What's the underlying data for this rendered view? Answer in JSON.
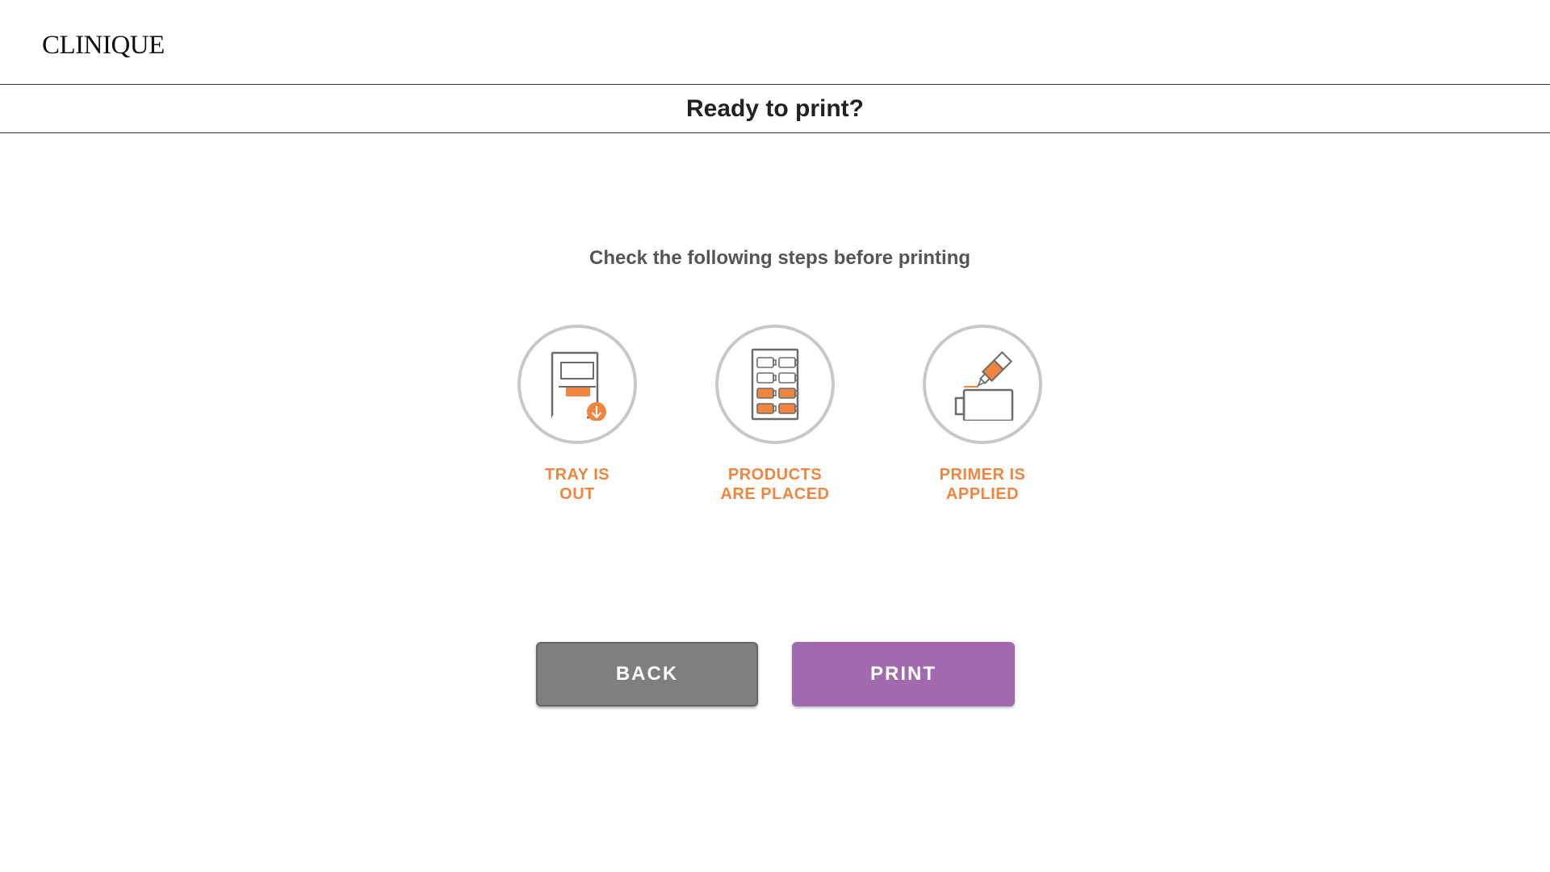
{
  "brand": {
    "logo_text": "CLINIQUE"
  },
  "page": {
    "title": "Ready to print?"
  },
  "instructions": {
    "text": "Check the following steps before printing"
  },
  "steps": [
    {
      "icon": "tray-out-icon",
      "line1": "TRAY IS",
      "line2": "OUT"
    },
    {
      "icon": "products-placed-icon",
      "line1": "PRODUCTS",
      "line2": "ARE PLACED"
    },
    {
      "icon": "primer-applied-icon",
      "line1": "PRIMER IS",
      "line2": "APPLIED"
    }
  ],
  "actions": {
    "back_label": "BACK",
    "print_label": "PRINT"
  },
  "colors": {
    "accent": "#f08540",
    "print_button": "#a26aae",
    "back_button": "#7f7f7f",
    "icon_ring": "#c8c8c8",
    "icon_line": "#6d6d6d"
  }
}
